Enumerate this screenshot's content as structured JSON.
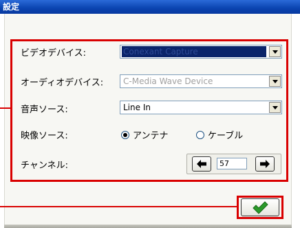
{
  "window": {
    "title": "設定"
  },
  "settings": {
    "video_device": {
      "label": "ビデオデバイス:",
      "value": "Conexant Capture"
    },
    "audio_device": {
      "label": "オーディオデバイス:",
      "value": "C-Media Wave Device"
    },
    "audio_source": {
      "label": "音声ソース:",
      "value": "Line In"
    },
    "video_source": {
      "label": "映像ソース:",
      "options": [
        {
          "label": "アンテナ",
          "checked": true
        },
        {
          "label": "ケーブル",
          "checked": false
        }
      ]
    },
    "channel": {
      "label": "チャンネル:",
      "value": "57"
    }
  },
  "colors": {
    "accent": "#d90000",
    "titlebar": "#0a44b0",
    "ok_check": "#2a9a2a"
  },
  "icons": {
    "prev": "left-arrow-icon",
    "next": "right-arrow-icon",
    "ok": "checkmark-icon"
  }
}
